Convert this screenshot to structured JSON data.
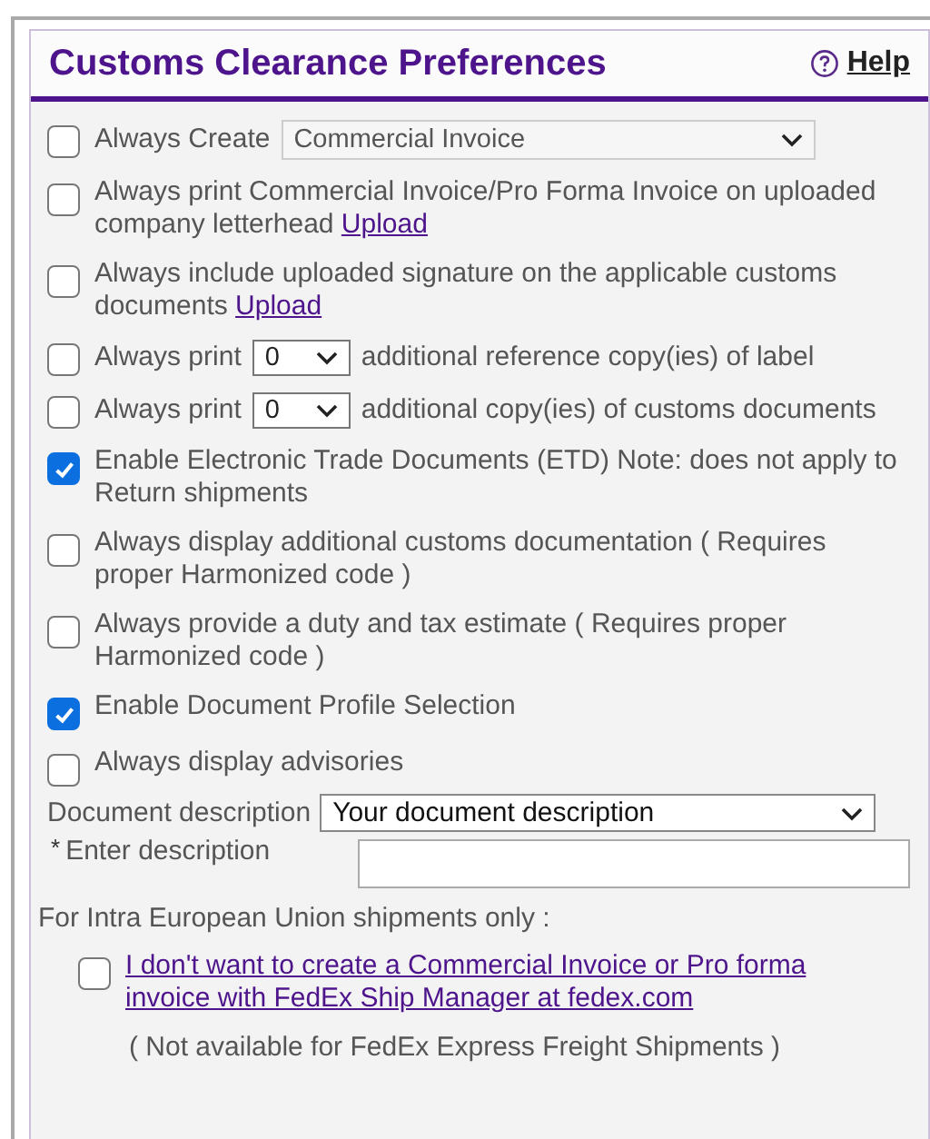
{
  "panel": {
    "title": "Customs Clearance Preferences",
    "help": "Help"
  },
  "options": [
    {
      "kind": "select",
      "checked": false,
      "label": "Always Create",
      "select": "Commercial Invoice"
    },
    {
      "kind": "text",
      "checked": false,
      "text": "Always print Commercial Invoice/Pro Forma Invoice on uploaded company letterhead",
      "link": "Upload"
    },
    {
      "kind": "text",
      "checked": false,
      "text": "Always include uploaded signature on the applicable customs documents",
      "link": "Upload"
    },
    {
      "kind": "copies",
      "checked": false,
      "label": "Always print",
      "select": "0",
      "suffix": "additional reference copy(ies) of label"
    },
    {
      "kind": "copies",
      "checked": false,
      "label": "Always print",
      "select": "0",
      "suffix": "additional copy(ies) of customs documents"
    },
    {
      "kind": "text",
      "checked": true,
      "text": "Enable Electronic Trade Documents (ETD) Note: does not apply to Return shipments"
    },
    {
      "kind": "text",
      "checked": false,
      "text": "Always display additional customs documentation ( Requires proper Harmonized code )"
    },
    {
      "kind": "text",
      "checked": false,
      "text": "Always provide a duty and tax estimate ( Requires proper Harmonized code )"
    },
    {
      "kind": "text",
      "checked": true,
      "text": "Enable Document Profile Selection"
    },
    {
      "kind": "text",
      "checked": false,
      "text": "Always display advisories"
    }
  ],
  "document_description": {
    "label": "Document description",
    "value": "Your document description"
  },
  "enter_description": {
    "required_mark": "*",
    "label": "Enter description"
  },
  "eu": {
    "heading": "For Intra European Union shipments only :",
    "checked": false,
    "link": "I don't want to create a Commercial Invoice or Pro forma invoice with FedEx Ship Manager at fedex.com",
    "note": "( Not available for FedEx Express Freight Shipments )"
  }
}
